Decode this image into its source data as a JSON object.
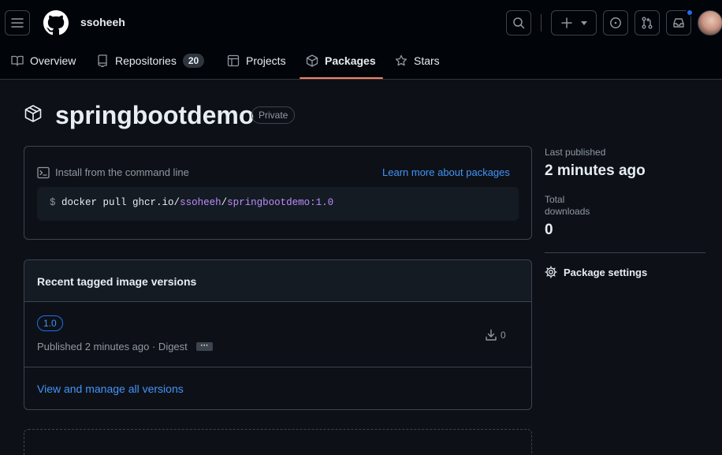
{
  "header": {
    "username": "ssoheeh",
    "nav": [
      {
        "label": "Overview"
      },
      {
        "label": "Repositories",
        "count": "20"
      },
      {
        "label": "Projects"
      },
      {
        "label": "Packages"
      },
      {
        "label": "Stars"
      }
    ]
  },
  "package": {
    "name": "springbootdemo",
    "visibility": "Private"
  },
  "install": {
    "title": "Install from the command line",
    "learn_more": "Learn more about packages",
    "cmd_prompt": "$",
    "cmd_base": "docker pull ghcr.io/",
    "cmd_user": "ssoheeh",
    "cmd_slash": "/",
    "cmd_image": "springbootdemo:1.0"
  },
  "versions": {
    "title": "Recent tagged image versions",
    "items": [
      {
        "tag": "1.0",
        "published": "Published 2 minutes ago · Digest",
        "more": "···",
        "downloads": "0"
      }
    ],
    "view_all": "View and manage all versions"
  },
  "sidebar": {
    "last_published_label": "Last published",
    "last_published_value": "2 minutes ago",
    "total_downloads_label_1": "Total",
    "total_downloads_label_2": "downloads",
    "total_downloads_value": "0",
    "settings_label": "Package settings"
  },
  "colors": {
    "background": "#0d1117",
    "header_bg": "#010409",
    "accent_link": "#4493f8",
    "tab_underline": "#f78166",
    "purple": "#bc8cff",
    "notification_dot": "#1f6feb"
  }
}
